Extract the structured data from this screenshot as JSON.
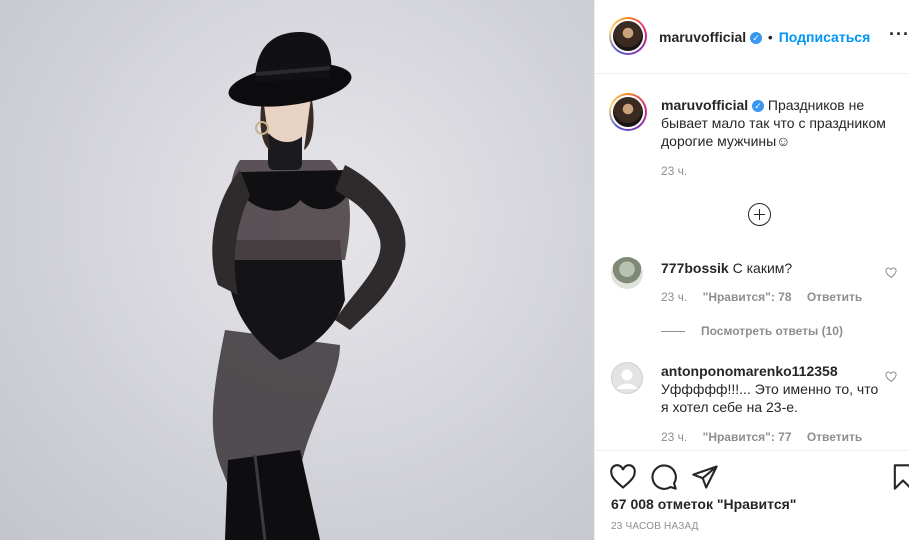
{
  "post": {
    "author": "maruvofficial",
    "follow_label": "Подписаться",
    "separator": "•",
    "more_label": "···",
    "caption": "Праздников не бывает мало так что с праздником дорогие мужчины☺",
    "caption_time": "23 ч."
  },
  "comments": [
    {
      "author": "777bossik",
      "text": "С каким?",
      "time": "23 ч.",
      "likes": "\"Нравится\": 78",
      "reply_label": "Ответить",
      "view_replies": "Посмотреть ответы (10)"
    },
    {
      "author": "antonponomarenko112358",
      "text": "Уффффф!!!... Это именно то, что я хотел себе на 23-е.",
      "time": "23 ч.",
      "likes": "\"Нравится\": 77",
      "reply_label": "Ответить"
    }
  ],
  "footer": {
    "likes_count": "67 008 отметок \"Нравится\"",
    "posted_ago": "23 ЧАСОВ НАЗАД"
  },
  "icons": {
    "verified": "verified-badge-icon",
    "like": "heart-icon",
    "comment": "comment-bubble-icon",
    "share": "paper-plane-icon",
    "save": "bookmark-icon",
    "load_more": "plus-circle-icon"
  },
  "colors": {
    "accent": "#0095f6",
    "verified": "#3897f0",
    "muted": "#8e8e8e",
    "text": "#262626"
  }
}
